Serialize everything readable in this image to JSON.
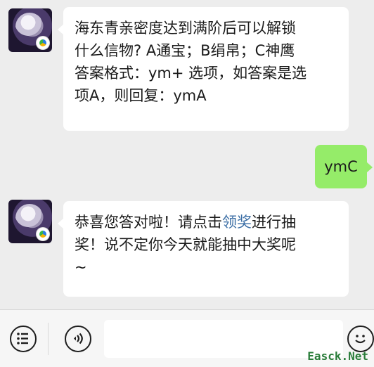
{
  "messages": [
    {
      "sender": "other",
      "lines": [
        "海东青亲密度达到满阶后可以解锁",
        "什么信物? A通宝；B绢帛；C神鹰",
        "答案格式：ym+ 选项，如答案是选",
        "项A，则回复：ymA"
      ]
    },
    {
      "sender": "me",
      "text": "ymC"
    },
    {
      "sender": "other",
      "line1_before": "恭喜您答对啦！请点击",
      "line1_link": "领奖",
      "line1_after": "进行抽",
      "line2": "奖！说不定你今天就能抽中大奖呢",
      "line3": "~"
    }
  ],
  "input_bar": {
    "menu_icon": "list-menu-icon",
    "voice_icon": "voice-icon",
    "emoji_icon": "emoji-icon",
    "input_value": ""
  },
  "watermark": "Easck.Net",
  "colors": {
    "background": "#ededed",
    "my_bubble": "#95ec69",
    "link": "#3b6ea5"
  }
}
